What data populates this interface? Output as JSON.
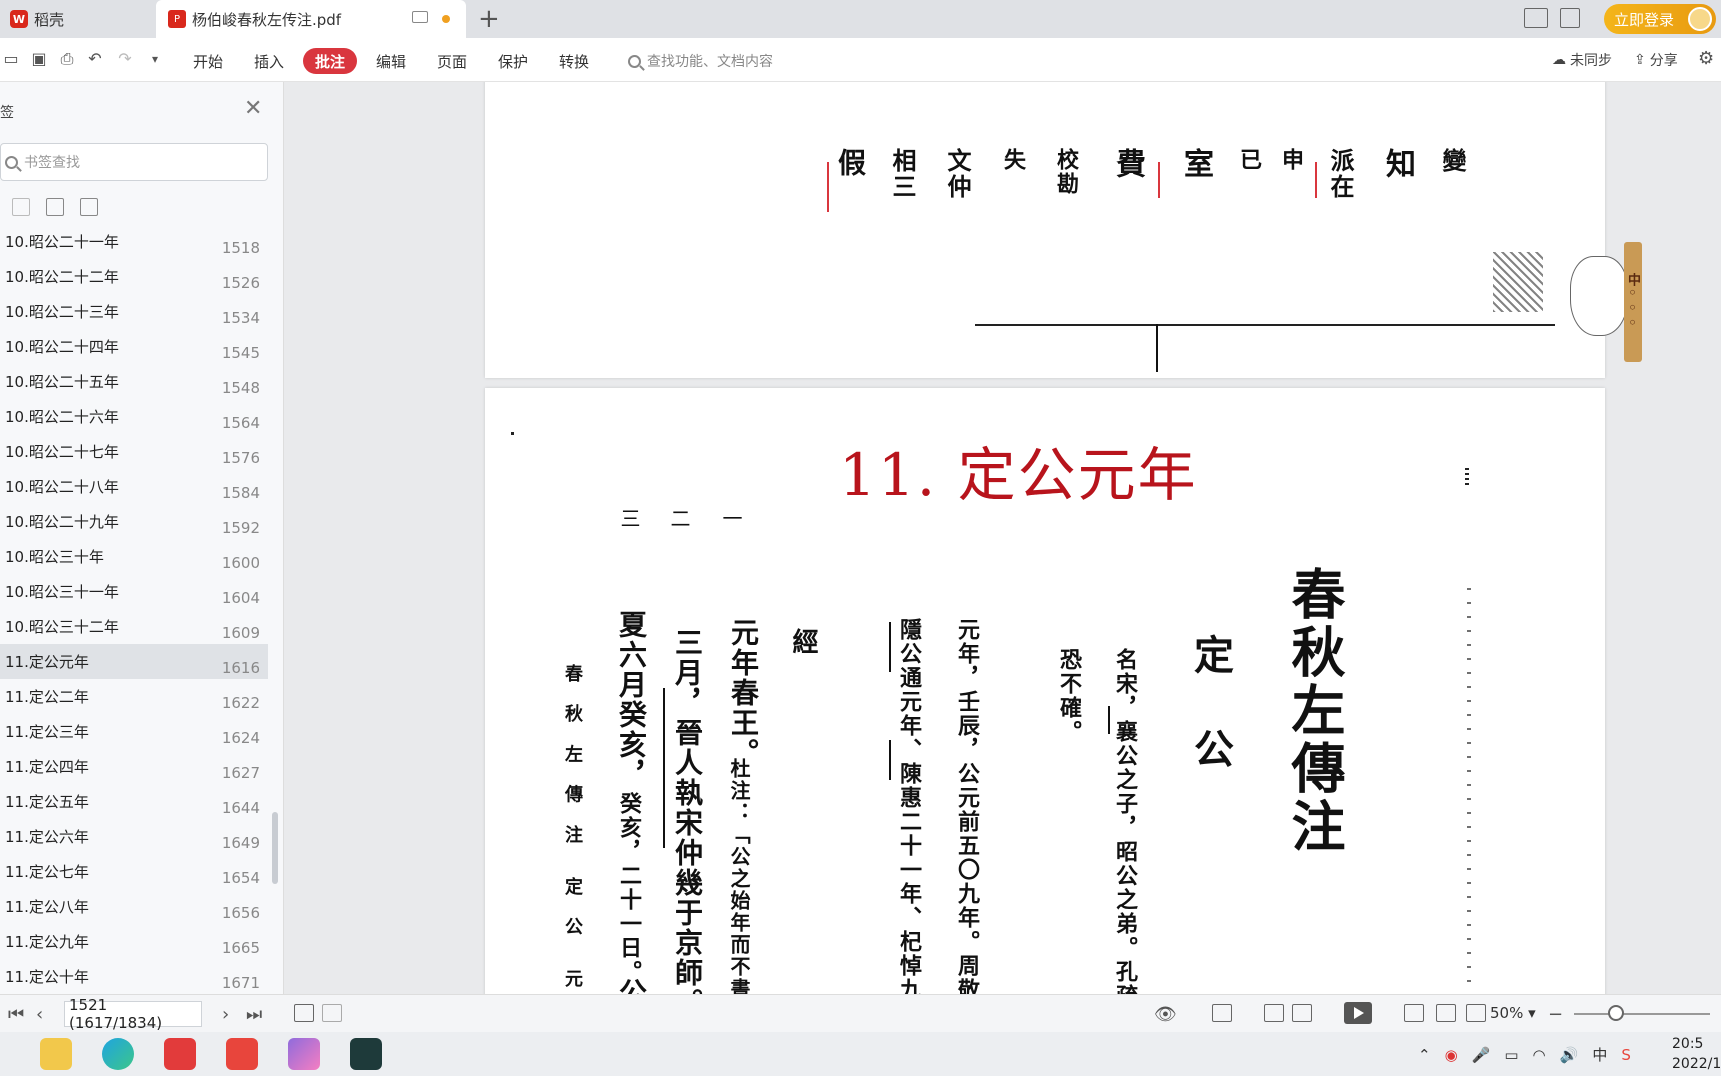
{
  "tabs": {
    "home_label": "稻壳",
    "doc_label": "杨伯峻春秋左传注.pdf",
    "new_tab": "+"
  },
  "account": {
    "login_label": "立即登录"
  },
  "toolbar": {
    "menus": [
      "开始",
      "插入",
      "批注",
      "编辑",
      "页面",
      "保护",
      "转换"
    ],
    "active_menu": "批注",
    "search_placeholder": "查找功能、文档内容",
    "sync_label": "未同步",
    "share_label": "分享"
  },
  "sidebar": {
    "title": "签",
    "search_placeholder": "书签查找",
    "bookmarks": [
      {
        "label": "10.昭公二十一年",
        "page": "1518"
      },
      {
        "label": "10.昭公二十二年",
        "page": "1526"
      },
      {
        "label": "10.昭公二十三年",
        "page": "1534"
      },
      {
        "label": "10.昭公二十四年",
        "page": "1545"
      },
      {
        "label": "10.昭公二十五年",
        "page": "1548"
      },
      {
        "label": "10.昭公二十六年",
        "page": "1564"
      },
      {
        "label": "10.昭公二十七年",
        "page": "1576"
      },
      {
        "label": "10.昭公二十八年",
        "page": "1584"
      },
      {
        "label": "10.昭公二十九年",
        "page": "1592"
      },
      {
        "label": "10.昭公三十年",
        "page": "1600"
      },
      {
        "label": "10.昭公三十一年",
        "page": "1604"
      },
      {
        "label": "10.昭公三十二年",
        "page": "1609"
      },
      {
        "label": "11.定公元年",
        "page": "1616"
      },
      {
        "label": "11.定公二年",
        "page": "1622"
      },
      {
        "label": "11.定公三年",
        "page": "1624"
      },
      {
        "label": "11.定公四年",
        "page": "1627"
      },
      {
        "label": "11.定公五年",
        "page": "1644"
      },
      {
        "label": "11.定公六年",
        "page": "1649"
      },
      {
        "label": "11.定公七年",
        "page": "1654"
      },
      {
        "label": "11.定公八年",
        "page": "1656"
      },
      {
        "label": "11.定公九年",
        "page": "1665"
      },
      {
        "label": "11.定公十年",
        "page": "1671"
      }
    ],
    "active_index": 12
  },
  "document": {
    "prev_page_fragments": [
      "假",
      "相三",
      "文仲",
      "失",
      "校勘",
      "費",
      "室",
      "已",
      "申",
      "派在",
      "知",
      "變"
    ],
    "chapter_title": "11. 定公元年",
    "para_numbers": [
      "三",
      "二",
      "一"
    ],
    "book_title": "春秋左傳注",
    "section_title": "定 公",
    "intro_col1": "名宋，襄公之子，昭公之弟。孔疏云：「史",
    "intro_col2": "恐不確。",
    "year_col1": "元年，壬辰，公元前五〇九年。周敬王十一",
    "year_col2": "隱公通元年、陳惠二十一年、杞悼九年、宋",
    "jing_label": "經",
    "text_col1": "元年春王。",
    "text_col1_note": "杜注：「公之始年而不書正",
    "text_col2": "三月，晉人執宋仲幾于京師。",
    "text_col3": "夏六月癸亥，",
    "text_col3_note": "癸亥，二十一日。",
    "text_col3_tail": "公之",
    "running_head": "春 秋 左 傳 注　定 公　元年"
  },
  "mascot": {
    "bar_text": "中◦◦◦"
  },
  "statusbar": {
    "page_field": "1521 (1617/1834)",
    "zoom": "50%"
  },
  "taskbar": {
    "clock_time": "20:5",
    "clock_date": "2022/1"
  }
}
